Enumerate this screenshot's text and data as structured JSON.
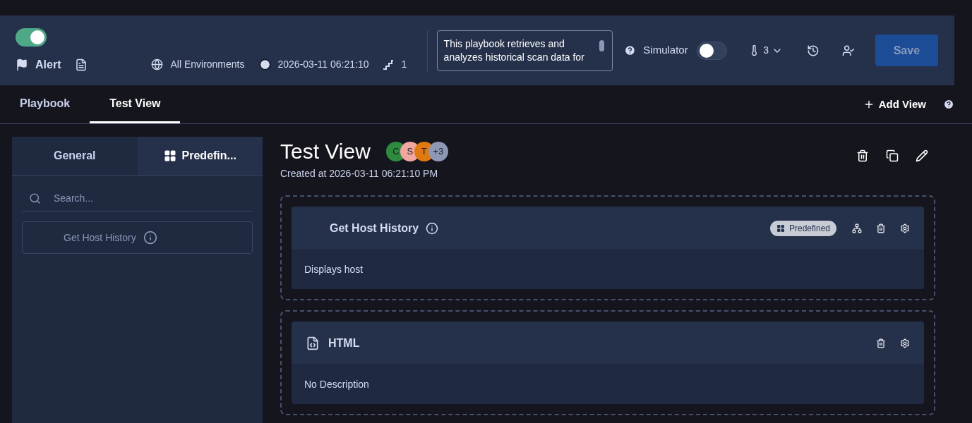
{
  "header": {
    "enabled": true,
    "meta": [
      {
        "kind": "type",
        "text": "Alert"
      },
      {
        "kind": "environment",
        "text": "All Environments"
      },
      {
        "kind": "time",
        "text": "2026-03-11 06:21:10"
      },
      {
        "kind": "steps",
        "text": "1"
      }
    ],
    "description": "This playbook retrieves and analyzes historical scan data for",
    "simulator": {
      "label": "Simulator",
      "on": false
    },
    "priority": "3",
    "save": "Save"
  },
  "tabs": [
    {
      "label": "Playbook",
      "selected": false
    },
    {
      "label": "Test View",
      "selected": true
    }
  ],
  "add_view": "Add View",
  "sidebar": {
    "tabs": [
      {
        "label": "General",
        "selected": false
      },
      {
        "label": "Predefin...",
        "selected": true
      }
    ],
    "search": {
      "placeholder": "Search..."
    },
    "items": [
      {
        "label": "Get Host History"
      }
    ]
  },
  "view": {
    "title": "Test View",
    "created": "Created at 2026-03-11 06:21:10 PM",
    "avatars": [
      {
        "text": "C",
        "color": "#2e8b3e"
      },
      {
        "text": "S",
        "color": "#f1a7a0"
      },
      {
        "text": "T",
        "color": "#e07a10"
      },
      {
        "text": "+3",
        "color": "#8e98b5"
      }
    ],
    "widgets": [
      {
        "kind": "predefined",
        "title": "Get Host History",
        "badge": "Predefined",
        "description": "Displays host"
      },
      {
        "kind": "html",
        "title": "HTML",
        "description": "No Description"
      }
    ]
  }
}
